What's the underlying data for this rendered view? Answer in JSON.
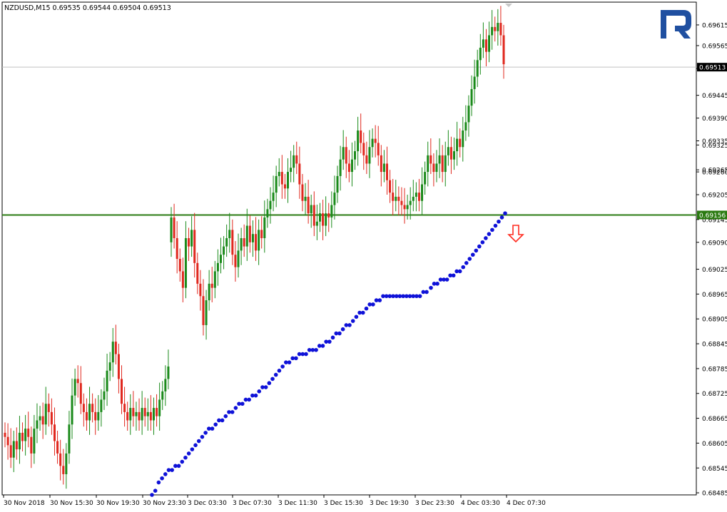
{
  "chart_data": {
    "type": "candlestick",
    "title": "NZDUSD,M15  0.69535 0.69544 0.69504 0.69513",
    "symbol": "NZDUSD",
    "timeframe": "M15",
    "ohlc_readout": [
      "0.69535",
      "0.69544",
      "0.69504",
      "0.69513"
    ],
    "ylim": [
      0.6848,
      0.6967
    ],
    "y_ticks": [
      "0.69615",
      "0.69565",
      "0.69510",
      "0.69445",
      "0.69390",
      "0.69335",
      "0.69325",
      "0.69265",
      "0.69260",
      "0.69205",
      "0.69145",
      "0.69090",
      "0.69025",
      "0.68965",
      "0.68905",
      "0.68845",
      "0.68785",
      "0.68725",
      "0.68665",
      "0.68605",
      "0.68545",
      "0.68485"
    ],
    "x_tick_labels": [
      "30 Nov 2018",
      "30 Nov 15:30",
      "30 Nov 19:30",
      "30 Nov 23:30",
      "3 Dec 03:30",
      "3 Dec 07:30",
      "3 Dec 11:30",
      "3 Dec 15:30",
      "3 Dec 19:30",
      "3 Dec 23:30",
      "4 Dec 03:30",
      "4 Dec 07:30"
    ],
    "current_price_label": "0.69513",
    "level_price_label": "0.69156",
    "current_price": 0.69513,
    "level_price": 0.69156,
    "candle_closes": [
      0.6862,
      0.686,
      0.6857,
      0.6861,
      0.6859,
      0.6863,
      0.6861,
      0.6864,
      0.6862,
      0.6858,
      0.6864,
      0.6866,
      0.6867,
      0.6865,
      0.687,
      0.6868,
      0.6865,
      0.6861,
      0.6858,
      0.6855,
      0.6853,
      0.6858,
      0.6865,
      0.6872,
      0.6876,
      0.6875,
      0.687,
      0.6868,
      0.6866,
      0.687,
      0.6868,
      0.6866,
      0.6868,
      0.6871,
      0.6873,
      0.6878,
      0.688,
      0.6885,
      0.6882,
      0.6876,
      0.687,
      0.6868,
      0.6866,
      0.6869,
      0.6867,
      0.6868,
      0.6866,
      0.6869,
      0.6867,
      0.6868,
      0.6866,
      0.6869,
      0.6867,
      0.6871,
      0.6873,
      0.6876,
      0.6879,
      0.6915,
      0.691,
      0.6905,
      0.6902,
      0.6898,
      0.691,
      0.6908,
      0.6912,
      0.6904,
      0.6899,
      0.6896,
      0.6889,
      0.6895,
      0.6899,
      0.6898,
      0.6902,
      0.6904,
      0.6906,
      0.6908,
      0.691,
      0.6912,
      0.6906,
      0.6903,
      0.6907,
      0.691,
      0.6908,
      0.6913,
      0.6909,
      0.6911,
      0.6907,
      0.6912,
      0.691,
      0.6915,
      0.6917,
      0.6919,
      0.6921,
      0.6925,
      0.6926,
      0.6923,
      0.6922,
      0.6926,
      0.6927,
      0.693,
      0.6928,
      0.6923,
      0.6919,
      0.692,
      0.6916,
      0.6918,
      0.6913,
      0.6914,
      0.6916,
      0.6913,
      0.6916,
      0.6915,
      0.6918,
      0.6921,
      0.6925,
      0.6929,
      0.6932,
      0.6928,
      0.6926,
      0.6929,
      0.6931,
      0.6936,
      0.6933,
      0.693,
      0.6928,
      0.6932,
      0.6934,
      0.6933,
      0.693,
      0.6926,
      0.6928,
      0.6924,
      0.6921,
      0.6919,
      0.692,
      0.6919,
      0.6918,
      0.6917,
      0.6918,
      0.6919,
      0.692,
      0.6921,
      0.6919,
      0.6923,
      0.6926,
      0.693,
      0.6928,
      0.6926,
      0.6928,
      0.693,
      0.6926,
      0.693,
      0.6932,
      0.6929,
      0.6931,
      0.6934,
      0.6932,
      0.6936,
      0.6938,
      0.6942,
      0.6946,
      0.6949,
      0.6953,
      0.6956,
      0.6958,
      0.6955,
      0.6959,
      0.6961,
      0.696,
      0.6962,
      0.6959,
      0.6952
    ],
    "indicator_dots": [
      [
        0.6848,
        0.6849,
        0.6851,
        0.6852,
        0.6853,
        0.6854,
        0.6854,
        0.6855,
        0.6855,
        0.6856,
        0.6857,
        0.6858,
        0.6859,
        0.686,
        0.6861,
        0.6862,
        0.6863,
        0.6864,
        0.6864,
        0.6865,
        0.6866,
        0.6866,
        0.6867,
        0.6868,
        0.6868,
        0.6869,
        0.687,
        0.687,
        0.6871,
        0.6871,
        0.6872,
        0.6872,
        0.6873,
        0.6874,
        0.6874,
        0.6875,
        0.6876,
        0.6877,
        0.6878,
        0.6879,
        0.688,
        0.688,
        0.6881,
        0.6881,
        0.6882,
        0.6882,
        0.6882,
        0.6883,
        0.6883,
        0.6883,
        0.6884,
        0.6884,
        0.6885,
        0.6885,
        0.6886,
        0.6887,
        0.6887,
        0.6888,
        0.6889,
        0.6889,
        0.689,
        0.6891,
        0.6892,
        0.6892,
        0.6893,
        0.6894,
        0.6894,
        0.6895,
        0.6895,
        0.6896,
        0.6896,
        0.6896,
        0.6896,
        0.6896,
        0.6896,
        0.6896,
        0.6896,
        0.6896,
        0.6896,
        0.6896,
        0.6896,
        0.6897,
        0.6897
      ],
      [
        0.6898,
        0.6899,
        0.6899,
        0.69,
        0.69,
        0.69,
        0.6901,
        0.6901,
        0.6902,
        0.6902,
        0.6903,
        0.6904,
        0.6905,
        0.6906,
        0.6907,
        0.6908,
        0.6909,
        0.691,
        0.6911,
        0.6912,
        0.6913,
        0.6914,
        0.6915,
        0.6916
      ]
    ],
    "grid": false,
    "colors": {
      "bull": "#1a8a1a",
      "bear": "#e0281e",
      "level": "#2a7a10",
      "indicator": "#0f12d8",
      "arrow": "#ff2a1e",
      "price_label_bg": "#000000",
      "level_label_bg": "#2a7a10",
      "logo": "#1f4fa0"
    }
  }
}
